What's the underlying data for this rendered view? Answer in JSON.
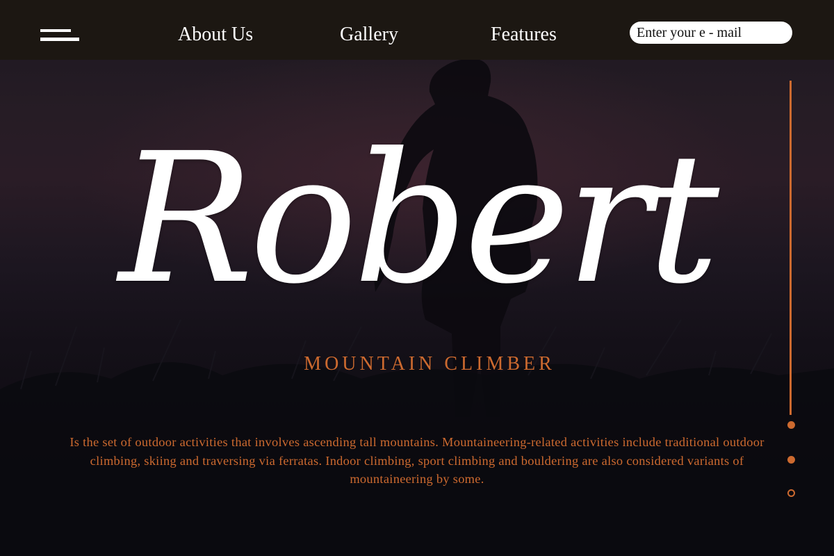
{
  "nav": {
    "links": [
      "About Us",
      "Gallery",
      "Features"
    ],
    "email_placeholder": "Enter your e - mail"
  },
  "hero": {
    "title": "Robert",
    "subtitle": "MOUNTAIN CLIMBER",
    "description": "Is the set of outdoor activities that involves ascending tall mountains. Mountaineering-related activities include traditional outdoor climbing, skiing and traversing via ferratas. Indoor climbing, sport climbing and bouldering are also considered variants of mountaineering by some."
  },
  "slider": {
    "slide_count": 3,
    "active_index": 2
  },
  "colors": {
    "accent": "#cd6a2f",
    "topbar": "#1c1712",
    "text": "#ffffff"
  },
  "icons": [
    "menu-icon"
  ]
}
